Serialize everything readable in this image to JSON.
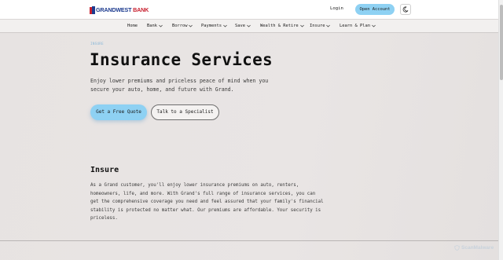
{
  "header": {
    "logo_main": "GRANDWEST",
    "logo_bank": "BANK",
    "login_label": "Login",
    "open_account_label": "Open Account",
    "theme_icon": "moon-icon"
  },
  "nav": {
    "items": [
      {
        "label": "Home",
        "dropdown": false
      },
      {
        "label": "Bank",
        "dropdown": true
      },
      {
        "label": "Borrow",
        "dropdown": true
      },
      {
        "label": "Payments",
        "dropdown": true
      },
      {
        "label": "Save",
        "dropdown": true
      },
      {
        "label": "Wealth & Retire",
        "dropdown": true
      },
      {
        "label": "Insure",
        "dropdown": true
      },
      {
        "label": "Learn & Plan",
        "dropdown": true
      }
    ]
  },
  "hero": {
    "breadcrumb": "INSURE",
    "title": "Insurance Services",
    "subtitle": "Enjoy lower premiums and priceless peace of mind when you secure your auto, home, and future with Grand.",
    "primary_cta": "Get a Free Quote",
    "secondary_cta": "Talk to a Specialist"
  },
  "section": {
    "title": "Insure",
    "body": "As a Grand customer, you'll enjoy lower insurance premiums on auto, renters, homeowners, life, and more. With Grand's full range of insurance services, you can get the comprehensive coverage you need and feel assured that your family's financial stability is protected no matter what. Our premiums are affordable. Your security is priceless."
  },
  "watermark": {
    "text": "ScanMalware"
  },
  "colors": {
    "accent": "#8ed1f3",
    "brand_blue": "#1d3b8f",
    "brand_red": "#c8202f",
    "background": "#e8e4e3"
  }
}
